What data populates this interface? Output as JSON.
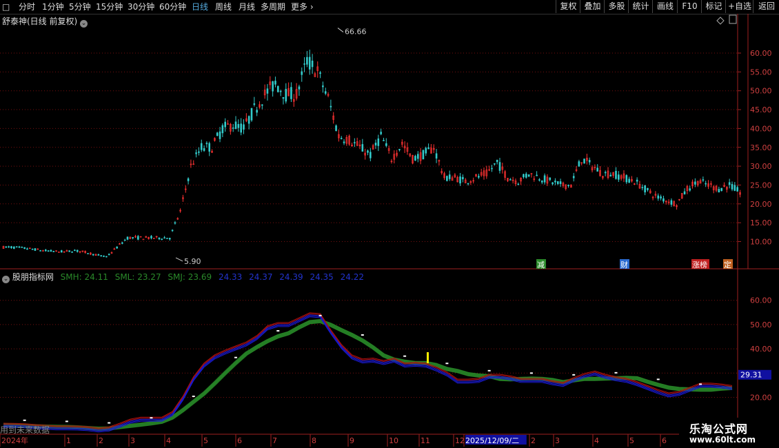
{
  "toolbar": {
    "periods": [
      "分时",
      "1分钟",
      "5分钟",
      "15分钟",
      "30分钟",
      "60分钟",
      "日线",
      "周线",
      "月线",
      "多周期",
      "更多"
    ],
    "active": "日线",
    "right_buttons": [
      "复权",
      "叠加",
      "多股",
      "统计",
      "画线",
      "F10",
      "标记",
      "+自选",
      "返回"
    ]
  },
  "main_panel": {
    "title": "舒泰神(日线 前复权)",
    "high_label": "66.66",
    "low_label": "5.90",
    "events": [
      {
        "label": "减",
        "color": "#2a8a2a"
      },
      {
        "label": "财",
        "color": "#2a6ad0"
      },
      {
        "label": "涨榜",
        "color": "#c02020"
      },
      {
        "label": "定",
        "color": "#c06020"
      }
    ]
  },
  "indicator_panel": {
    "title": "股朋指标网",
    "values": [
      {
        "text": "SMH: 24.11",
        "color": "#2a8a2a"
      },
      {
        "text": "SML: 23.27",
        "color": "#2a8a2a"
      },
      {
        "text": "SMJ: 23.69",
        "color": "#2a8a2a"
      },
      {
        "text": "24.33",
        "color": "#2233cc"
      },
      {
        "text": "24.37",
        "color": "#2233cc"
      },
      {
        "text": "24.39",
        "color": "#2233cc"
      },
      {
        "text": "24.35",
        "color": "#2233cc"
      },
      {
        "text": "24.22",
        "color": "#2233cc"
      }
    ],
    "current_value": "29.31",
    "future_note": "用到未来数据"
  },
  "date_axis": {
    "labels": [
      "2024年",
      "1",
      "2",
      "3",
      "4",
      "5",
      "6",
      "7",
      "8",
      "9",
      "10",
      "11",
      "12",
      "2025/12/09/二",
      "2",
      "3",
      "4",
      "5",
      "6"
    ],
    "cursor": "2025/12/09/二"
  },
  "watermark": {
    "line1": "乐淘公式网",
    "line2": "www.60lt.com"
  },
  "colors": {
    "up": "#ff3333",
    "down": "#33cccc",
    "grid": "#7a1010",
    "axis": "#a02020",
    "green": "#1e6e1e",
    "red": "#aa1010",
    "blue": "#1a1acc"
  },
  "chart_data": [
    {
      "type": "candlestick",
      "title": "舒泰神(日线 前复权)",
      "ylim": [
        5,
        68
      ],
      "y_ticks": [
        10,
        15,
        20,
        25,
        30,
        35,
        40,
        45,
        50,
        55,
        60
      ],
      "series": [
        {
          "values_approx_close": [
            8.5,
            8.3,
            8.0,
            7.6,
            7.4,
            7.3,
            7.6,
            7.2,
            6.5,
            5.9,
            8.5,
            11,
            11,
            11,
            11,
            11,
            18,
            30,
            35,
            35,
            40,
            41,
            40,
            45,
            49,
            52,
            49,
            49,
            58,
            55,
            48,
            38,
            37,
            35,
            33,
            38,
            32,
            36,
            32,
            33,
            35,
            27,
            27,
            26,
            27,
            28,
            31,
            27,
            26,
            28,
            27,
            26,
            25,
            25,
            32,
            30,
            28,
            28,
            27,
            26,
            24,
            22,
            21,
            20,
            24,
            26,
            25,
            24,
            25,
            23
          ]
        }
      ],
      "annotations": [
        {
          "label": "66.66",
          "type": "high"
        },
        {
          "label": "5.90",
          "type": "low"
        }
      ]
    },
    {
      "type": "line",
      "title": "股朋指标网",
      "ylim": [
        11,
        68
      ],
      "y_ticks": [
        20,
        30,
        40,
        50,
        60
      ],
      "series": [
        {
          "name": "SMH",
          "color": "#2a8a2a",
          "value": 24.11
        },
        {
          "name": "SML",
          "color": "#2a8a2a",
          "value": 23.27
        },
        {
          "name": "SMJ",
          "color": "#2a8a2a",
          "value": 23.69
        }
      ],
      "fast_lines_last": [
        24.33,
        24.37,
        24.39,
        24.35,
        24.22
      ]
    }
  ]
}
